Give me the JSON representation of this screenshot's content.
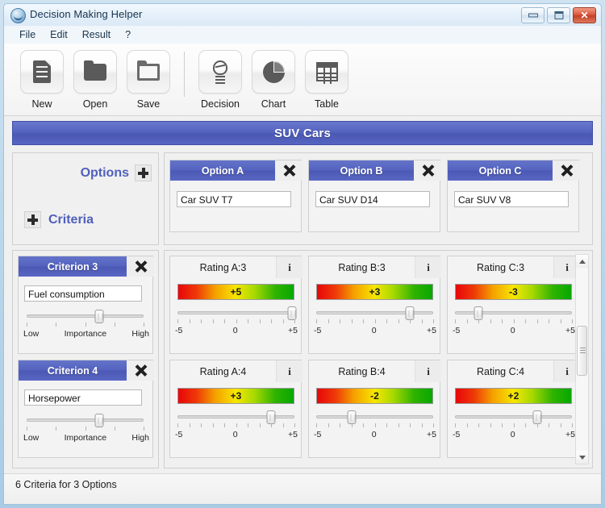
{
  "window": {
    "title": "Decision Making Helper",
    "icon": "app-icon",
    "controls": {
      "minimize": "minimize",
      "maximize": "maximize",
      "close": "close"
    }
  },
  "menu": {
    "items": [
      "File",
      "Edit",
      "Result",
      "?"
    ]
  },
  "toolbar": {
    "groups": [
      [
        {
          "label": "New",
          "icon": "document-icon"
        },
        {
          "label": "Open",
          "icon": "folder-icon"
        },
        {
          "label": "Save",
          "icon": "folder-open-icon"
        }
      ],
      [
        {
          "label": "Decision",
          "icon": "lightbulb-icon"
        },
        {
          "label": "Chart",
          "icon": "pie-chart-icon"
        },
        {
          "label": "Table",
          "icon": "table-grid-icon"
        }
      ]
    ]
  },
  "banner": {
    "title": "SUV Cars",
    "color": "#5463bf"
  },
  "panels": {
    "options_label": "Options",
    "criteria_label": "Criteria",
    "add_glyph": "+"
  },
  "options": [
    {
      "header": "Option A",
      "value": "Car SUV T7",
      "close": "x"
    },
    {
      "header": "Option B",
      "value": "Car SUV D14",
      "close": "x"
    },
    {
      "header": "Option C",
      "value": "Car SUV V8",
      "close": "x"
    }
  ],
  "criteria": [
    {
      "header": "Criterion 3",
      "name": "Fuel consumption",
      "close": "x",
      "importance_pct": 62,
      "scale": {
        "low": "Low",
        "mid": "Importance",
        "high": "High"
      }
    },
    {
      "header": "Criterion 4",
      "name": "Horsepower",
      "close": "x",
      "importance_pct": 62,
      "scale": {
        "low": "Low",
        "mid": "Importance",
        "high": "High"
      }
    }
  ],
  "ratings": {
    "scale": {
      "min": "-5",
      "mid": "0",
      "max": "+5"
    },
    "info_glyph": "i",
    "rows": [
      [
        {
          "header": "Rating A:3",
          "value": "+5",
          "pct": 100
        },
        {
          "header": "Rating B:3",
          "value": "+3",
          "pct": 80
        },
        {
          "header": "Rating C:3",
          "value": "-3",
          "pct": 20
        }
      ],
      [
        {
          "header": "Rating A:4",
          "value": "+3",
          "pct": 80
        },
        {
          "header": "Rating B:4",
          "value": "-2",
          "pct": 30
        },
        {
          "header": "Rating C:4",
          "value": "+2",
          "pct": 70
        }
      ]
    ]
  },
  "scrollbar": {
    "thumb_pct": 43
  },
  "statusbar": {
    "text": "6 Criteria for 3 Options"
  }
}
